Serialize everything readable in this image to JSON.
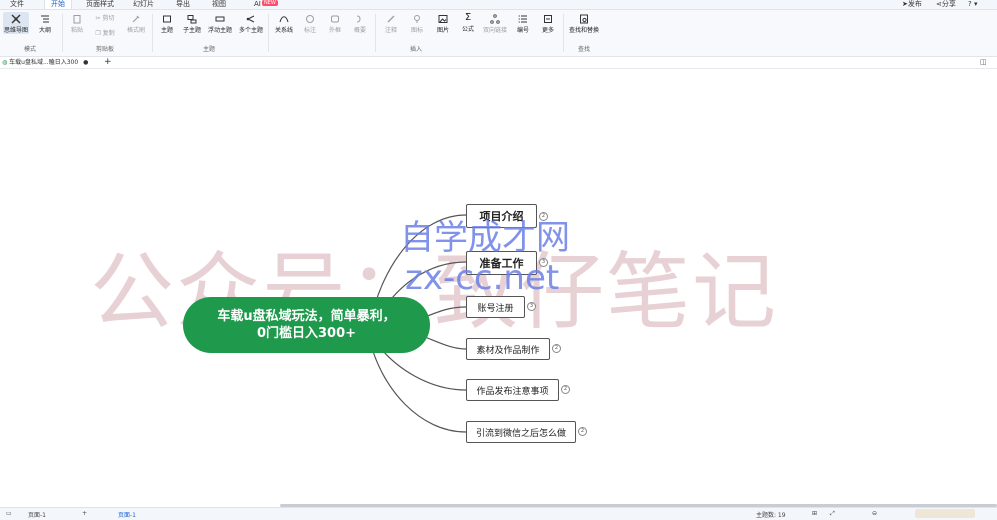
{
  "menubar": {
    "tabs": [
      {
        "label": "文件"
      },
      {
        "label": "开始"
      },
      {
        "label": "页面样式"
      },
      {
        "label": "幻灯片"
      },
      {
        "label": "导出"
      },
      {
        "label": "视图"
      },
      {
        "label": "AI"
      }
    ],
    "active_tab": "开始",
    "ai_badge": "NEW",
    "right": {
      "publish": "发布",
      "share": "分享",
      "help": "?"
    }
  },
  "ribbon": {
    "buttons": {
      "mindmap": "思维导图",
      "outline": "大纲",
      "paste": "粘贴",
      "cut": "剪切",
      "copy": "复制",
      "format_painter": "格式刷",
      "topic": "主题",
      "subtopic": "子主题",
      "float_topic": "浮动主题",
      "multi_topic": "多个主题",
      "relation": "关系线",
      "label": "标注",
      "summary": "外框",
      "frame": "概要",
      "note": "注释",
      "icon": "图标",
      "image": "图片",
      "formula": "公式",
      "flowchart": "双向链接",
      "numbering": "编号",
      "more": "更多",
      "find_replace": "查找和替换"
    },
    "groups": {
      "mode": "模式",
      "clipboard": "剪贴板",
      "topic": "主题",
      "insert": "插入",
      "find": "查找"
    }
  },
  "document_tab": {
    "title": "车载u盘私域...瞌日入300"
  },
  "mindmap": {
    "central": "车载u盘私域玩法，简单暴利，\n0门槛日入300+",
    "branches": [
      {
        "label": "项目介绍",
        "count": "2"
      },
      {
        "label": "准备工作",
        "count": "3"
      },
      {
        "label": "账号注册",
        "count": "3"
      },
      {
        "label": "素材及作品制作",
        "count": "2"
      },
      {
        "label": "作品发布注意事项",
        "count": "2"
      },
      {
        "label": "引流到微信之后怎么做",
        "count": "2"
      }
    ]
  },
  "watermarks": {
    "main": "公众号：致仔笔记",
    "secondary_line1": "自学成才网",
    "secondary_line2": "zx-cc.net"
  },
  "statusbar": {
    "page_label": "页面-1",
    "page_tab": "页面-1",
    "topic_count": "主题数: 19"
  },
  "colors": {
    "central_bg": "#1f9a4d",
    "branch_line": "#555555",
    "watermark_main": "#e3c9cd",
    "watermark_blue": "#6b7fe6",
    "watermark_purple": "#d26ad6",
    "accent": "#1a5fd0"
  }
}
